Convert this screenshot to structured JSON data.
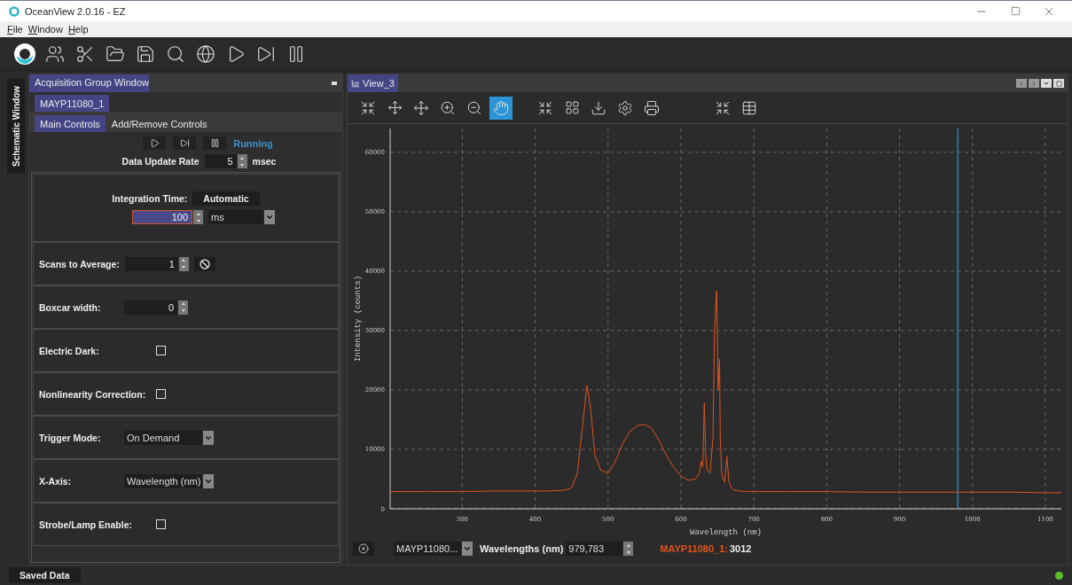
{
  "window": {
    "title": "OceanView 2.0.16  - EZ"
  },
  "menu": [
    "File",
    "Window",
    "Help"
  ],
  "side_tab": {
    "label": "Schematic Window",
    "selected": true
  },
  "acquisition": {
    "title": "Acquisition Group Window",
    "device_tab": {
      "label": "MAYP11080_1",
      "selected": true
    },
    "tabs": [
      {
        "label": "Main Controls",
        "selected": true
      },
      {
        "label": "Add/Remove Controls",
        "selected": false
      }
    ],
    "status": "Running",
    "update_rate": {
      "label": "Data Update Rate",
      "value": "5",
      "unit": "msec"
    },
    "integration": {
      "label": "Integration Time:",
      "button": "Automatic",
      "value": "100",
      "unit": "ms"
    },
    "controls": [
      {
        "kind": "spin_clear",
        "label": "Scans to Average:",
        "value": "1"
      },
      {
        "kind": "spin",
        "label": "Boxcar width:",
        "value": "0"
      },
      {
        "kind": "checkbox",
        "label": "Electric Dark:",
        "checked": false
      },
      {
        "kind": "checkbox",
        "label": "Nonlinearity Correction:",
        "checked": false
      },
      {
        "kind": "select",
        "label": "Trigger Mode:",
        "value": "On Demand"
      },
      {
        "kind": "select",
        "label": "X-Axis:",
        "value": "Wavelength (nm)"
      },
      {
        "kind": "checkbox",
        "label": "Strobe/Lamp Enable:",
        "checked": false
      }
    ]
  },
  "view": {
    "tab": "View_3",
    "chart_data": {
      "type": "line",
      "xlabel": "Wavelength (nm)",
      "ylabel": "Intensity (counts)",
      "xlim": [
        201,
        1122
      ],
      "ylim": [
        0,
        64000
      ],
      "grid": true,
      "xticks": [
        300,
        400,
        500,
        600,
        700,
        800,
        900,
        1000,
        1100
      ],
      "yticks": [
        0,
        10000,
        20000,
        30000,
        40000,
        50000,
        60000
      ],
      "x": [
        201,
        250,
        300,
        350,
        400,
        420,
        440,
        450,
        458,
        465,
        471,
        476,
        482,
        490,
        500,
        510,
        520,
        530,
        540,
        551,
        560,
        570,
        580,
        590,
        600,
        610,
        620,
        625,
        628,
        630,
        632,
        634,
        636,
        640,
        644,
        646,
        649,
        651,
        653,
        654,
        656,
        658,
        660,
        663,
        666,
        669,
        672,
        680,
        690,
        700,
        750,
        800,
        850,
        900,
        950,
        1000,
        1050,
        1100,
        1122
      ],
      "series": [
        {
          "name": "MAYP11080_1",
          "color": "#e0531f",
          "values": [
            2900,
            2900,
            2900,
            3000,
            3000,
            3000,
            3100,
            3500,
            6000,
            14000,
            20700,
            17000,
            9000,
            6500,
            6000,
            8000,
            11000,
            13000,
            14000,
            14200,
            13500,
            11500,
            9000,
            7000,
            5500,
            4800,
            5000,
            6000,
            8000,
            7000,
            17800,
            9000,
            6500,
            6000,
            12000,
            30000,
            36700,
            20000,
            25200,
            12000,
            6000,
            5000,
            4500,
            8800,
            4500,
            3600,
            3200,
            3000,
            2900,
            2900,
            2900,
            2900,
            2800,
            2800,
            2800,
            2800,
            2800,
            2700,
            2700
          ]
        }
      ],
      "ref_lines": [
        {
          "axis": "x",
          "value": 980,
          "color": "#2f7fb0"
        }
      ]
    },
    "footer": {
      "device": "MAYP11080...",
      "wl_label": "Wavelengths (nm)",
      "wl_value": "979,783",
      "separator": ":",
      "reading": "3012"
    }
  },
  "status_bar": {
    "saved": "Saved Data",
    "connected": true
  }
}
